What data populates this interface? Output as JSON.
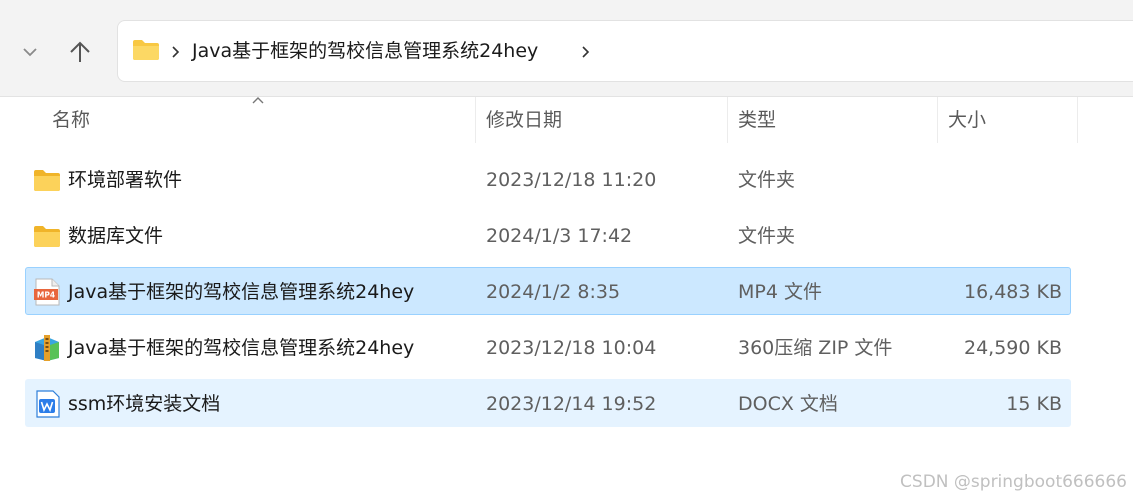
{
  "address": {
    "path_label": "Java基于框架的驾校信息管理系统24hey"
  },
  "columns": {
    "name": "名称",
    "date": "修改日期",
    "type": "类型",
    "size": "大小"
  },
  "files": [
    {
      "name": "环境部署软件",
      "date": "2023/12/18 11:20",
      "type": "文件夹",
      "size": "",
      "icon": "folder-icon",
      "state": "normal"
    },
    {
      "name": "数据库文件",
      "date": "2024/1/3 17:42",
      "type": "文件夹",
      "size": "",
      "icon": "folder-icon",
      "state": "normal"
    },
    {
      "name": "Java基于框架的驾校信息管理系统24hey",
      "date": "2024/1/2 8:35",
      "type": "MP4 文件",
      "size": "16,483 KB",
      "icon": "mp4-file-icon",
      "state": "selected"
    },
    {
      "name": "Java基于框架的驾校信息管理系统24hey",
      "date": "2023/12/18 10:04",
      "type": "360压缩 ZIP 文件",
      "size": "24,590 KB",
      "icon": "zip-archive-icon",
      "state": "normal"
    },
    {
      "name": "ssm环境安装文档",
      "date": "2023/12/14 19:52",
      "type": "DOCX 文档",
      "size": "15 KB",
      "icon": "docx-file-icon",
      "state": "hover"
    }
  ],
  "mp4_icon_text": "MP4",
  "watermark": "CSDN @springboot666666",
  "colors": {
    "selected_bg": "#cce8ff",
    "selected_border": "#99d1ff",
    "hover_bg": "#e5f3ff",
    "folder": "#f8c843"
  }
}
